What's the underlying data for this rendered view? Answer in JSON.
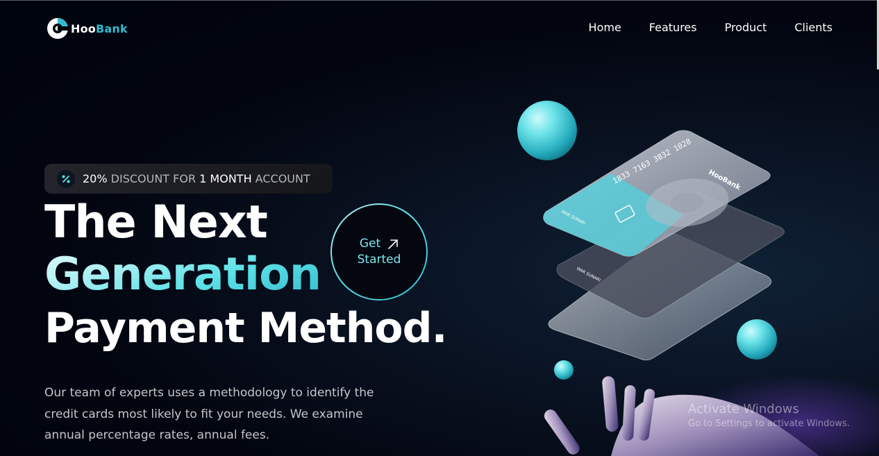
{
  "brand": {
    "name_part1": "Hoo",
    "name_part2": "Bank",
    "accent_color": "#33bbcf",
    "icon": "hoobank-logo-icon"
  },
  "nav": {
    "items": [
      "Home",
      "Features",
      "Product",
      "Clients"
    ]
  },
  "badge": {
    "icon": "discount-icon",
    "percent": "20%",
    "text1": " DISCOUNT FOR ",
    "months": "1 MONTH",
    "text2": " ACCOUNT"
  },
  "headline": {
    "line1": "The Next",
    "line2": "Generation",
    "line3": "Payment Method."
  },
  "cta": {
    "line1": "Get",
    "line2": "Started",
    "icon": "arrow-up-right-icon"
  },
  "description": "Our team of experts uses a methodology to identify the credit cards most likely to fit your needs. We examine annual percentage rates, annual fees.",
  "cards": {
    "number": "1833 7163 3832 1028",
    "holder": "WAK SUNARI",
    "brand": "HooBank"
  },
  "watermark": {
    "title": "Activate Windows",
    "subtitle": "Go to Settings to activate Windows."
  },
  "colors": {
    "background": "#00040f",
    "gradient_light": "#def9fa",
    "gradient_mid": "#5ce1e6",
    "gradient_dark": "#33bbcf",
    "text_dim": "#b5b6ba"
  }
}
